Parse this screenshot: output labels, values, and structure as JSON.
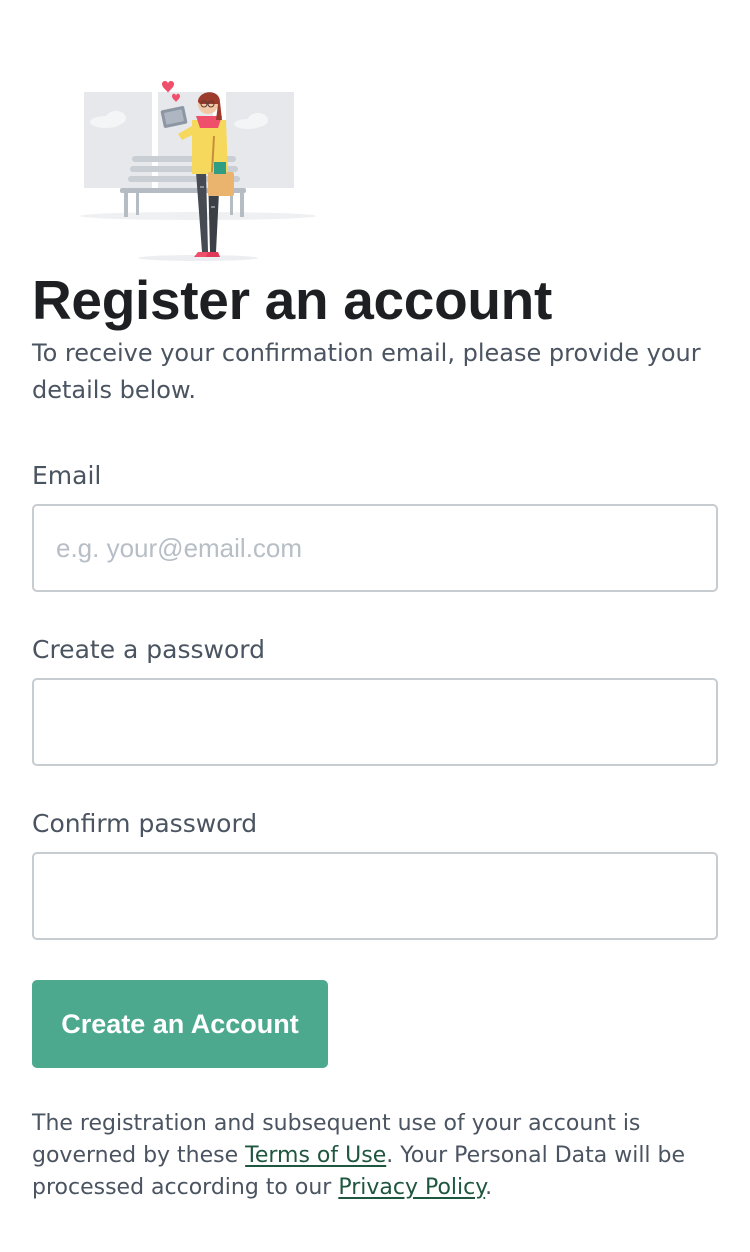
{
  "header": {
    "title": "Register an account",
    "subtitle": "To receive your confirmation email, please provide your details below."
  },
  "form": {
    "email": {
      "label": "Email",
      "value": "",
      "placeholder": "e.g. your@email.com"
    },
    "password": {
      "label": "Create a password",
      "value": "",
      "placeholder": ""
    },
    "confirm_password": {
      "label": "Confirm password",
      "value": "",
      "placeholder": ""
    },
    "submit_label": "Create an Account"
  },
  "legal": {
    "text_1": "The registration and subsequent use of your account is governed by these ",
    "terms_link": "Terms of Use",
    "text_2": ". Your Personal Data will be processed according to our ",
    "privacy_link": "Privacy Policy",
    "text_3": "."
  },
  "icons": {
    "illustration": "woman-with-tablet-and-bench-illustration"
  },
  "colors": {
    "accent": "#4ca98d",
    "heading": "#1d1f22",
    "body_text": "#4b5461",
    "input_border": "#c7ccd1",
    "placeholder": "#b7bec6",
    "link": "#1f5640"
  }
}
